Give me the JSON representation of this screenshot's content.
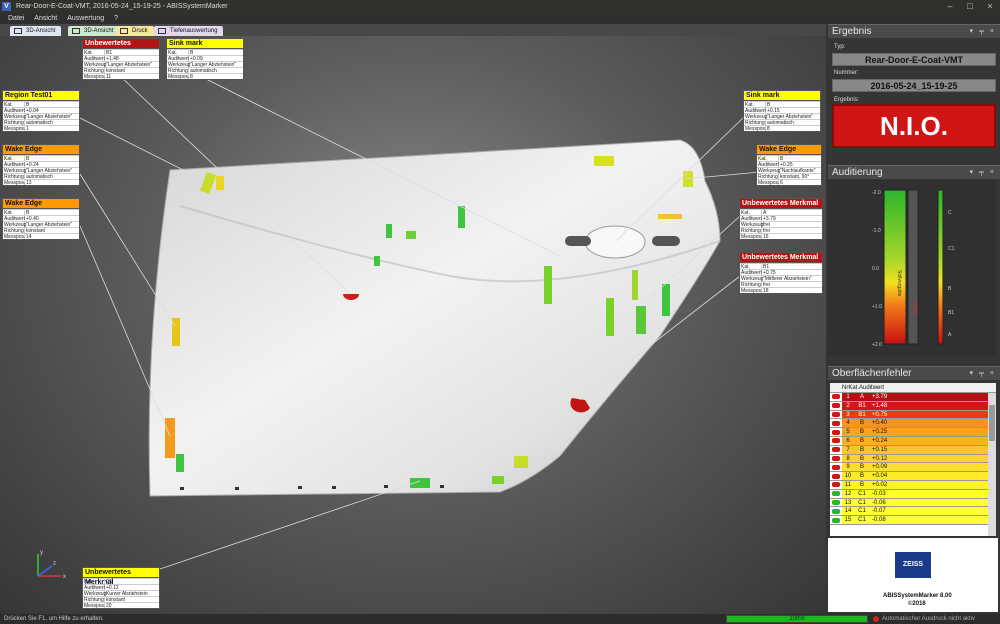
{
  "window": {
    "title": "Rear-Door-E-Coat-VMT, 2016-05-24_15-19-25 - ABISSystemMarker",
    "app_icon": "V"
  },
  "menu": [
    "Datei",
    "Ansicht",
    "Auswertung",
    "?"
  ],
  "tabs": [
    {
      "label": "3D-Ansicht",
      "color": "#dfe6f2"
    },
    {
      "label": "3D-Ansicht",
      "color": "#cfe6cf"
    },
    {
      "label": "Druck",
      "color": "#f5e89a"
    },
    {
      "label": "Tiefenauswertung",
      "color": "#e4d6ef"
    }
  ],
  "row_keys": [
    "Kat.",
    "Auditwert",
    "Werkzeug",
    "Richtung",
    "Messpos."
  ],
  "cards": [
    {
      "id": "c1",
      "title": "Unbewertetes Merkmal",
      "style": "red",
      "values": [
        "B1",
        "+1.48",
        "\"Langer Abziehstein\"",
        "konstant",
        "11"
      ]
    },
    {
      "id": "c2",
      "title": "Sink mark",
      "style": "yellow",
      "values": [
        "B",
        "+0.09",
        "\"Langer Abziehstein\"",
        "automatisch",
        "8"
      ]
    },
    {
      "id": "c3",
      "title": "Region Test01",
      "style": "yellow",
      "values": [
        "B",
        "+0.04",
        "\"Langer Abziehstein\"",
        "automatisch",
        "1"
      ]
    },
    {
      "id": "c4",
      "title": "Wake Edge",
      "style": "orange",
      "values": [
        "B",
        "+0.24",
        "\"Langer Abziehstein\"",
        "automatisch",
        "13"
      ]
    },
    {
      "id": "c5",
      "title": "Wake Edge",
      "style": "orange",
      "values": [
        "B",
        "+0.40",
        "\"Langer Abziehstein\"",
        "konstant",
        "14"
      ]
    },
    {
      "id": "c6",
      "title": "Sink mark",
      "style": "yellow",
      "values": [
        "B",
        "+0.15",
        "\"Langer Abziehstein\"",
        "automatisch",
        "8"
      ]
    },
    {
      "id": "c7",
      "title": "Wake Edge",
      "style": "orange",
      "values": [
        "B",
        "+0.25",
        "\"Nachlaufkante\"",
        "konstant, 90°",
        "6"
      ]
    },
    {
      "id": "c8",
      "title": "Unbewertetes Merkmal",
      "style": "red",
      "values": [
        "A",
        "+3.79",
        "frei",
        "frei",
        "16"
      ]
    },
    {
      "id": "c9",
      "title": "Unbewertetes Merkmal",
      "style": "red",
      "values": [
        "B1",
        "+0.75",
        "\"Mittlerer Abziehstein\"",
        "frei",
        "18"
      ]
    },
    {
      "id": "c10",
      "title": "Unbewertetes Merkmal",
      "style": "yellow",
      "values": [
        "C1",
        "+0.12",
        "Kurzer Abziehstein",
        "konstant",
        "20"
      ]
    }
  ],
  "status": {
    "help_text": "Drücken Sie F1, um Hilfe zu erhalten.",
    "progress": "100%",
    "progress_value": 1.0,
    "autoprint": "Automatischer Ausdruck nicht aktiv"
  },
  "result_panel": {
    "header": "Ergebnis",
    "typ_label": "Typ:",
    "typ": "Rear-Door-E-Coat-VMT",
    "nummer_label": "Nummer:",
    "nummer": "2016-05-24_15-19-25",
    "ergebnis_label": "Ergebnis:",
    "ergebnis": "N.I.O."
  },
  "audit_panel": {
    "header": "Auditierung",
    "left_ticks": [
      "-2.0",
      "-1.0",
      "0.0",
      "+1.0",
      "+2.0"
    ],
    "right_ticks": [
      "C",
      "C1",
      "B",
      "B1",
      "A"
    ],
    "bar_labels": [
      "Sollvorgabe",
      "Istwert"
    ]
  },
  "defects_panel": {
    "header": "Oberflächenfehler",
    "columns": [
      "Nr",
      "Kat.",
      "Auditwert"
    ],
    "rows": [
      {
        "nr": "1",
        "kat": "A",
        "wert": "+3.79",
        "color": "#b31212",
        "text": "#fff"
      },
      {
        "nr": "2",
        "kat": "B1",
        "wert": "+1.48",
        "color": "#d01818",
        "text": "#fff"
      },
      {
        "nr": "3",
        "kat": "B1",
        "wert": "+0.75",
        "color": "#e83a1a",
        "text": "#fff"
      },
      {
        "nr": "4",
        "kat": "B",
        "wert": "+0.40",
        "color": "#f7941d",
        "text": "#111"
      },
      {
        "nr": "5",
        "kat": "B",
        "wert": "+0.25",
        "color": "#f9a51c",
        "text": "#111"
      },
      {
        "nr": "6",
        "kat": "B",
        "wert": "+0.24",
        "color": "#fab21e",
        "text": "#111"
      },
      {
        "nr": "7",
        "kat": "B",
        "wert": "+0.15",
        "color": "#fcc52a",
        "text": "#111"
      },
      {
        "nr": "8",
        "kat": "B",
        "wert": "+0.12",
        "color": "#fdd42c",
        "text": "#111"
      },
      {
        "nr": "9",
        "kat": "B",
        "wert": "+0.09",
        "color": "#fee02c",
        "text": "#111"
      },
      {
        "nr": "10",
        "kat": "B",
        "wert": "+0.04",
        "color": "#ffea2a",
        "text": "#111"
      },
      {
        "nr": "11",
        "kat": "B",
        "wert": "+0.02",
        "color": "#fff22a",
        "text": "#111"
      },
      {
        "nr": "12",
        "kat": "C1",
        "wert": "-0.03",
        "color": "#ffff2a",
        "text": "#111"
      },
      {
        "nr": "13",
        "kat": "C1",
        "wert": "-0.06",
        "color": "#ffff33",
        "text": "#111"
      },
      {
        "nr": "14",
        "kat": "C1",
        "wert": "-0.07",
        "color": "#ffff33",
        "text": "#111"
      },
      {
        "nr": "15",
        "kat": "C1",
        "wert": "-0.08",
        "color": "#ffff33",
        "text": "#111"
      }
    ]
  },
  "branding": {
    "logo": "ZEISS",
    "product": "ABISSystemMarker 8.00",
    "copyright": "©2016"
  },
  "axis_labels": {
    "x": "x",
    "y": "y",
    "z": "z"
  }
}
